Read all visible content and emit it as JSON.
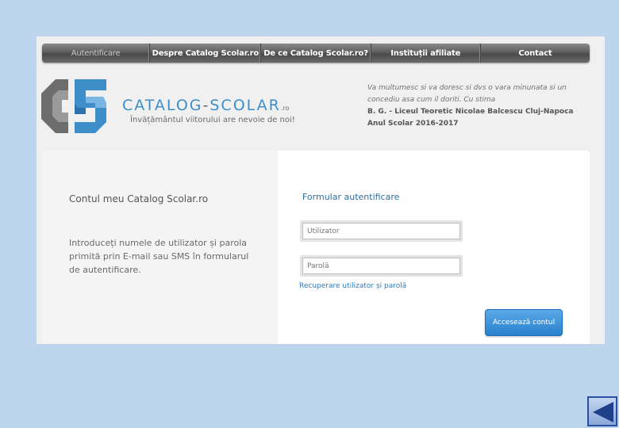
{
  "nav": {
    "items": [
      {
        "label": "Autentificare",
        "active": true
      },
      {
        "label": "Despre Catalog  Scolar.ro",
        "active": false
      },
      {
        "label": "De ce Catalog  Scolar.ro?",
        "active": false
      },
      {
        "label": "Instituții afiliate",
        "active": false
      },
      {
        "label": "Contact",
        "active": false
      }
    ]
  },
  "logo": {
    "word1": "CATALOG",
    "dash": "-",
    "word2": "SCOLAR",
    "suffix": ".ro",
    "tagline": "Învățământul viitorului are nevoie de noi!"
  },
  "message": {
    "line1": "Va multumesc si va doresc si dvs o vara minunata si un concediu asa cum il doriti. Cu stima",
    "signature": "B. G. - Liceul Teoretic Nicolae Balcescu Cluj-Napoca",
    "year": "Anul Scolar 2016-2017"
  },
  "left": {
    "title": "Contul meu Catalog  Scolar.ro",
    "description": "Introduceți numele de utilizator și parola primită prin E-mail sau SMS în formularul de autentificare."
  },
  "form": {
    "title": "Formular autentificare",
    "username_placeholder": "Utilizator",
    "password_placeholder": "Parolă",
    "recover_link": "Recuperare utilizator și parolă",
    "submit_label": "Accesează contul"
  },
  "colors": {
    "accent": "#2a80cd",
    "logo_blue": "#3d8ec9",
    "logo_gray": "#6a6a6a",
    "page_bg": "#bcd5ec"
  },
  "icons": {
    "back": "back-arrow-icon"
  }
}
